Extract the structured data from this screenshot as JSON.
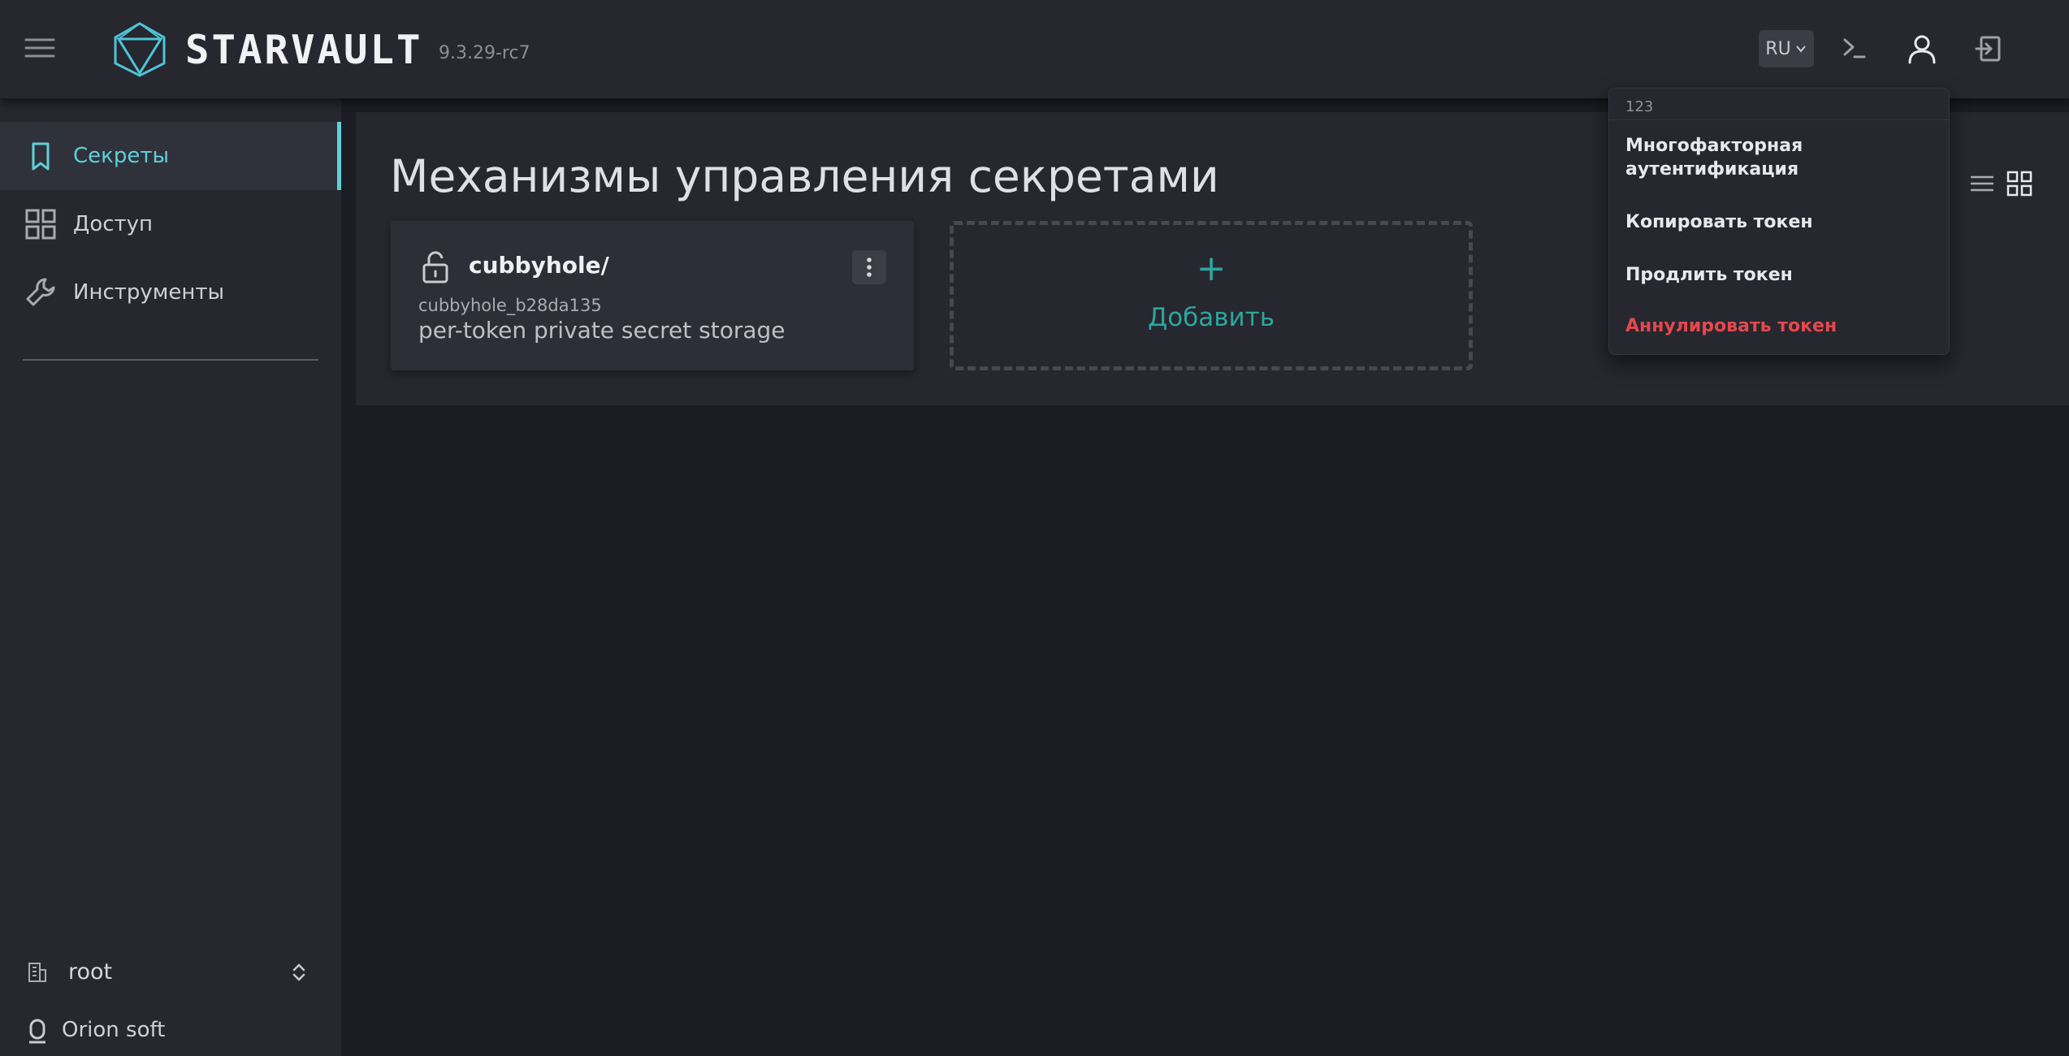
{
  "header": {
    "brand": "STARVAULT",
    "version": "9.3.29-rc7",
    "language": "RU"
  },
  "sidebar": {
    "items": [
      {
        "label": "Секреты",
        "icon": "bookmark-icon",
        "active": true
      },
      {
        "label": "Доступ",
        "icon": "grid-icon",
        "active": false
      },
      {
        "label": "Инструменты",
        "icon": "wrench-icon",
        "active": false
      }
    ],
    "namespace": "root",
    "organization": "Orion soft"
  },
  "main": {
    "title": "Механизмы управления секретами",
    "engines": [
      {
        "path": "cubbyhole/",
        "accessor": "cubbyhole_b28da135",
        "description": "per-token private secret storage"
      }
    ],
    "add_label": "Добавить",
    "add_symbol": "+"
  },
  "user_menu": {
    "username": "123",
    "items": [
      {
        "label": "Многофакторная аутентификация"
      },
      {
        "label": "Копировать токен"
      },
      {
        "label": "Продлить токен"
      },
      {
        "label": "Аннулировать токен"
      }
    ]
  },
  "colors": {
    "accent": "#5fd0d8",
    "add_accent": "#2ea69c",
    "danger": "#e5484d",
    "background": "#1c1d24",
    "surface": "#26272f"
  }
}
